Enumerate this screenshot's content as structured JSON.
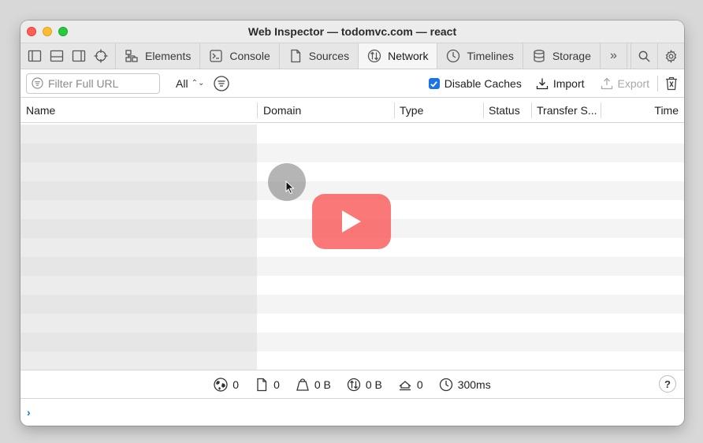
{
  "window": {
    "title": "Web Inspector — todomvc.com — react"
  },
  "tabs": [
    {
      "label": "Elements",
      "icon": "elements-icon"
    },
    {
      "label": "Console",
      "icon": "console-icon"
    },
    {
      "label": "Sources",
      "icon": "sources-icon"
    },
    {
      "label": "Network",
      "icon": "network-icon",
      "active": true
    },
    {
      "label": "Timelines",
      "icon": "timelines-icon"
    },
    {
      "label": "Storage",
      "icon": "storage-icon"
    }
  ],
  "more_tabs": "»",
  "filter": {
    "placeholder": "Filter Full URL",
    "type_select": "All"
  },
  "toolbar": {
    "disable_caches_label": "Disable Caches",
    "disable_caches_checked": true,
    "import_label": "Import",
    "export_label": "Export"
  },
  "columns": [
    "Name",
    "Domain",
    "Type",
    "Status",
    "Transfer S...",
    "Time"
  ],
  "status": {
    "resources": "0",
    "documents": "0",
    "size": "0 B",
    "transferred": "0 B",
    "cached": "0",
    "time": "300ms"
  },
  "help_label": "?",
  "console_prompt": "›",
  "colors": {
    "accent": "#1a73e8",
    "play_button": "#fa5a5a"
  }
}
